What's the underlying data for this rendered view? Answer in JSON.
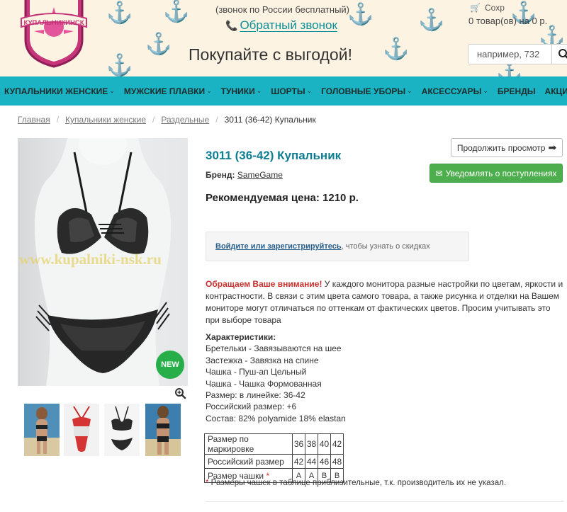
{
  "header": {
    "logo_text": "КУПАЛЬНИКИНСК",
    "top_note": "(звонок по России бесплатный)",
    "callback_label": "Обратный звонок",
    "slogan": "Покупайте с выгодой!",
    "cart_top": "Сохр",
    "cart_text": "0 товар(ов) на 0 р.",
    "search_placeholder": "например, 732"
  },
  "nav": {
    "items": [
      {
        "label": "КУПАЛЬНИКИ ЖЕНСКИЕ"
      },
      {
        "label": "МУЖСКИЕ ПЛАВКИ"
      },
      {
        "label": "ТУНИКИ"
      },
      {
        "label": "ШОРТЫ"
      },
      {
        "label": "ГОЛОВНЫЕ УБОРЫ"
      },
      {
        "label": "АКСЕССУАРЫ"
      },
      {
        "label": "БРЕНДЫ"
      },
      {
        "label": "АКЦИИ"
      }
    ]
  },
  "breadcrumb": {
    "home": "Главная",
    "category": "Купальники женские",
    "subcategory": "Раздельные",
    "current": "3011 (36-42) Купальник"
  },
  "product": {
    "title": "3011 (36-42) Купальник",
    "brand_label": "Бренд:",
    "brand": "SameGame",
    "price_label": "Рекомендуемая цена: 1210 р.",
    "watermark": "www.kupalniki-nsk.ru",
    "badge": "NEW"
  },
  "actions": {
    "continue_label": "Продолжить просмотр",
    "notify_label": "Уведомлять о поступлениях"
  },
  "login": {
    "link_text": "Войдите или зарегистрируйтесь",
    "rest_text": ", чтобы узнать о скидках"
  },
  "notice": {
    "strong": "Обращаем Ваше внимание!",
    "text": " У каждого монитора разные настройки по цветам, яркости и контрастности. В связи с этим цвета самого товара, а также рисунка и отделки на Вашем мониторе могут отличаться по оттенкам от фактических цветов. Просим учитывать это при выборе товара"
  },
  "specs": {
    "title": "Характеристики:",
    "lines": [
      "Бретельки - Завязываются на шее",
      "Застежка - Завязка на спине",
      "Чашка - Пуш-ап Цельный",
      "Чашка - Чашка Формованная",
      "Размер: в линейке: 36-42",
      "Российский размер: +6",
      "Состав: 82% polyamide 18% elastan"
    ]
  },
  "size_table": {
    "rows": [
      {
        "label": "Размер по маркировке",
        "values": [
          "36",
          "38",
          "40",
          "42"
        ]
      },
      {
        "label": "Российский размер",
        "values": [
          "42",
          "44",
          "46",
          "48"
        ]
      },
      {
        "label": "Размер чашки",
        "values": [
          "A",
          "A",
          "B",
          "B"
        ]
      }
    ],
    "star": "*"
  },
  "footnote": {
    "star": "*",
    "text": " Размеры чашек в таблице приблизительные, т.к. производитель их не указал."
  },
  "colors": {
    "nav_bg": "#1ab3c3",
    "title": "#0f7e92",
    "notify_green": "#4cae4c",
    "badge_green": "#27ae49",
    "alert_red": "#c9302c",
    "header_bg": "#fdf3e2"
  }
}
